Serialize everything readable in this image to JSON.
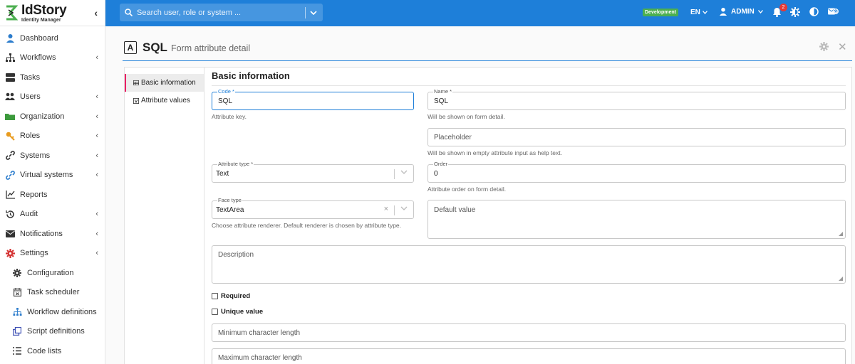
{
  "brand": {
    "name": "IdStory",
    "subtitle": "Identity Manager"
  },
  "sidebar": {
    "items": [
      {
        "label": "Dashboard",
        "icon": "user-icon",
        "chevron": false
      },
      {
        "label": "Workflows",
        "icon": "sitemap-icon",
        "chevron": true
      },
      {
        "label": "Tasks",
        "icon": "server-icon",
        "chevron": false
      },
      {
        "label": "Users",
        "icon": "users-icon",
        "chevron": true
      },
      {
        "label": "Organization",
        "icon": "folder-icon",
        "chevron": true
      },
      {
        "label": "Roles",
        "icon": "key-icon",
        "chevron": true
      },
      {
        "label": "Systems",
        "icon": "link-icon",
        "chevron": true
      },
      {
        "label": "Virtual systems",
        "icon": "virtual-link-icon",
        "chevron": true
      },
      {
        "label": "Reports",
        "icon": "chart-icon",
        "chevron": false
      },
      {
        "label": "Audit",
        "icon": "history-icon",
        "chevron": true
      },
      {
        "label": "Notifications",
        "icon": "envelope-icon",
        "chevron": true
      },
      {
        "label": "Settings",
        "icon": "cog-red-icon",
        "chevron": true
      }
    ],
    "subitems": [
      {
        "label": "Configuration",
        "icon": "cog-icon"
      },
      {
        "label": "Task scheduler",
        "icon": "calendar-icon"
      },
      {
        "label": "Workflow definitions",
        "icon": "sitemap-blue-icon"
      },
      {
        "label": "Script definitions",
        "icon": "clone-icon"
      },
      {
        "label": "Code lists",
        "icon": "list-icon"
      }
    ]
  },
  "topbar": {
    "search_placeholder": "Search user, role or system ...",
    "environment": "Development",
    "language": "EN",
    "user": "ADMIN",
    "notification_count": "2"
  },
  "page": {
    "title": "SQL",
    "subtitle": "Form attribute detail",
    "icon_letter": "A"
  },
  "tabs": [
    {
      "label": "Basic information",
      "active": true
    },
    {
      "label": "Attribute values",
      "active": false
    }
  ],
  "form": {
    "section_title": "Basic information",
    "code": {
      "label": "Code *",
      "value": "SQL",
      "help": "Attribute key."
    },
    "name": {
      "label": "Name *",
      "value": "SQL",
      "help": "Will be shown on form detail."
    },
    "placeholder": {
      "placeholder": "Placeholder",
      "help": "Will be shown in empty attribute input as help text."
    },
    "attribute_type": {
      "label": "Attribute type *",
      "value": "Text"
    },
    "order": {
      "label": "Order",
      "value": "0",
      "help": "Attribute order on form detail."
    },
    "face_type": {
      "label": "Face type",
      "value": "TextArea",
      "help": "Choose attribute renderer. Default renderer is chosen by attribute type."
    },
    "default_value": {
      "placeholder": "Default value"
    },
    "description": {
      "placeholder": "Description"
    },
    "required": {
      "label": "Required"
    },
    "unique": {
      "label": "Unique value"
    },
    "min_length": {
      "placeholder": "Minimum character length"
    },
    "max_length": {
      "placeholder": "Maximum character length"
    }
  },
  "colors": {
    "primary": "#1e7fd9",
    "accent_pink": "#e91e63",
    "env_green": "#4caf50",
    "badge_red": "#e53935"
  }
}
